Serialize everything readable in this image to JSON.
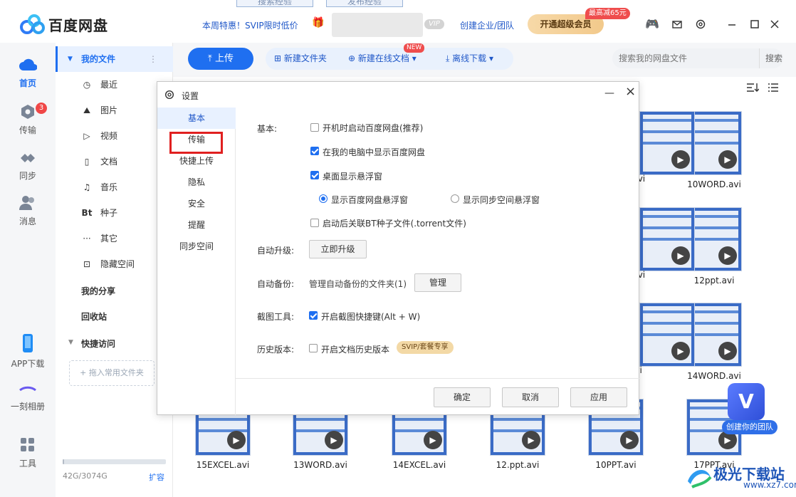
{
  "topbar": {
    "tabs": [
      "搜索经验",
      "发布经验"
    ],
    "app_title": "百度网盘",
    "promo": "本周特惠！SVIP限时低价",
    "vip_badge": "VIP",
    "enterprise": "创建企业/团队",
    "svip_button": "开通超级会员",
    "discount_badge": "最高减65元",
    "icons": [
      "game-icon",
      "mail-icon",
      "settings-icon",
      "minimize-icon",
      "maximize-icon",
      "close-icon"
    ]
  },
  "rail": {
    "home": "首页",
    "transfer": "传输",
    "transfer_badge": "3",
    "sync": "同步",
    "message": "消息",
    "app_download": "APP下载",
    "album": "一刻相册",
    "tools": "工具"
  },
  "sidebar": {
    "my_files": "我的文件",
    "items": [
      {
        "icon": "clock-icon",
        "glyph": "◷",
        "label": "最近"
      },
      {
        "icon": "image-icon",
        "glyph": "⛰",
        "label": "图片"
      },
      {
        "icon": "video-icon",
        "glyph": "▷",
        "label": "视频"
      },
      {
        "icon": "document-icon",
        "glyph": "▯",
        "label": "文档"
      },
      {
        "icon": "music-icon",
        "glyph": "♫",
        "label": "音乐"
      },
      {
        "icon": "bt-icon",
        "glyph": "Bt",
        "label": "种子"
      },
      {
        "icon": "more-icon",
        "glyph": "···",
        "label": "其它"
      },
      {
        "icon": "lock-icon",
        "glyph": "⊡",
        "label": "隐藏空间"
      }
    ],
    "my_share": "我的分享",
    "recycle": "回收站",
    "quick_access": "快捷访问",
    "drag_drop": "+ 拖入常用文件夹",
    "quota": "42G/3074G",
    "quota_fraction": 0.014,
    "expand": "扩容"
  },
  "toolbar": {
    "upload": "上传",
    "new_folder": "新建文件夹",
    "new_online_doc": "新建在线文档",
    "new_badge": "NEW",
    "offline_download": "离线下载",
    "search_placeholder": "搜索我的网盘文件",
    "search_button": "搜索"
  },
  "files": {
    "row1": [
      "10WORD.avi",
      ").avi"
    ],
    "row2": [
      "12ppt.avi",
      ").avi"
    ],
    "row3": [
      "14WORD.avi",
      "avi"
    ],
    "row4": [
      "15EXCEL.avi",
      "13WORD.avi",
      "14EXCEL.avi",
      "12.ppt.avi",
      "10PPT.avi",
      "17PPT.avi"
    ]
  },
  "dialog": {
    "title": "设置",
    "nav": [
      "基本",
      "传输",
      "快捷上传",
      "隐私",
      "安全",
      "提醒",
      "同步空间"
    ],
    "basic_label": "基本:",
    "opt_autostart": "开机时启动百度网盘(推荐)",
    "opt_show_in_pc": "在我的电脑中显示百度网盘",
    "opt_float": "桌面显示悬浮窗",
    "radio_netdisk_float": "显示百度网盘悬浮窗",
    "radio_sync_float": "显示同步空间悬浮窗",
    "opt_bt": "启动后关联BT种子文件(.torrent文件)",
    "auto_upgrade_label": "自动升级:",
    "upgrade_now": "立即升级",
    "auto_backup_label": "自动备份:",
    "backup_desc": "管理自动备份的文件夹(1)",
    "manage": "管理",
    "screenshot_label": "截图工具:",
    "screenshot_opt": "开启截图快捷键(Alt + W)",
    "history_label": "历史版本:",
    "history_opt": "开启文档历史版本",
    "svip_tag": "SVIP/套餐专享",
    "ok": "确定",
    "cancel": "取消",
    "apply": "应用"
  },
  "floating": {
    "team_letter": "V",
    "team_label": "创建你的团队"
  },
  "watermark": {
    "text": "极光下载站",
    "url": "www.xz7.com"
  }
}
